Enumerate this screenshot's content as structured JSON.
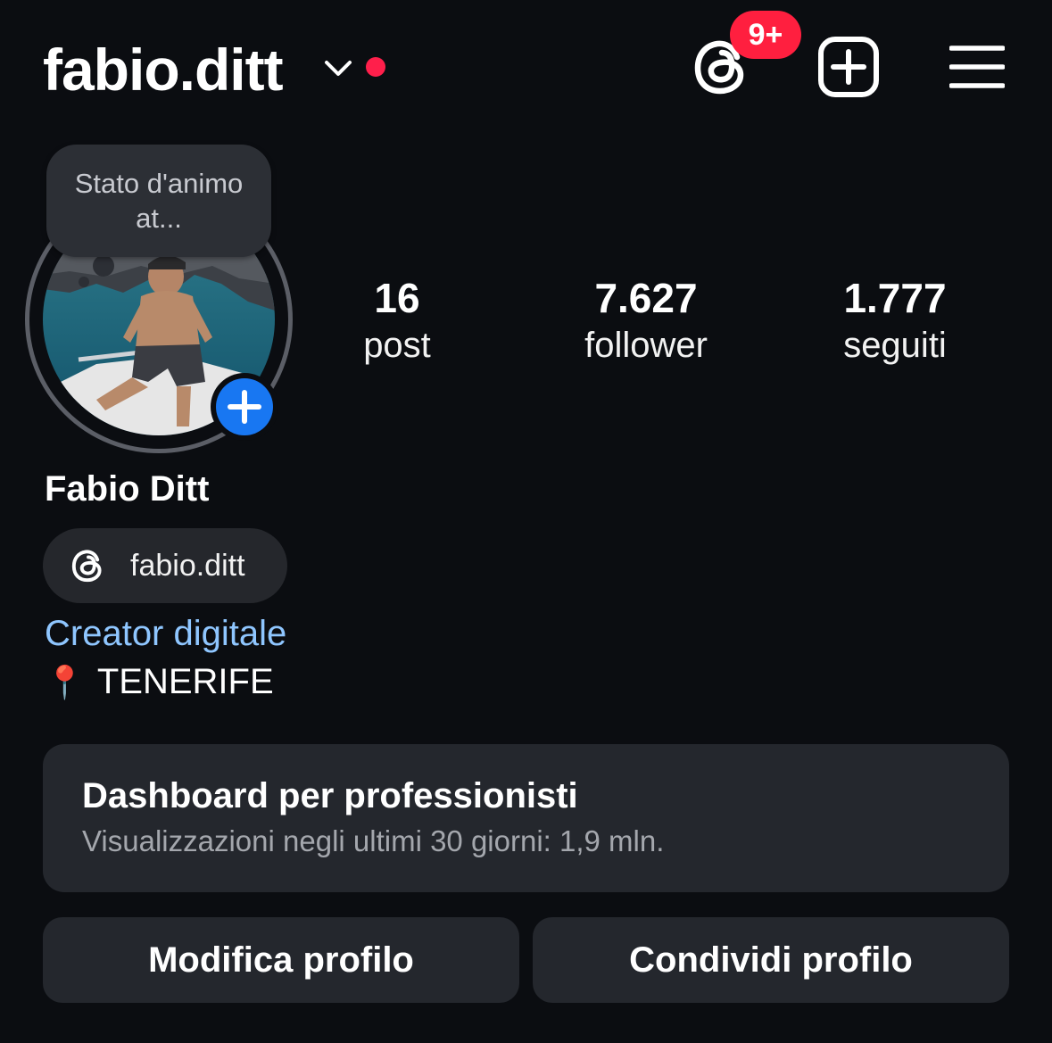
{
  "header": {
    "username": "fabio.ditt",
    "notification_badge": "9+",
    "accent_dot_color": "#ff1f4b"
  },
  "avatar": {
    "note_text": "Stato d'animo at...",
    "icon": "add-story-plus-icon"
  },
  "stats": [
    {
      "value": "16",
      "label": "post"
    },
    {
      "value": "7.627",
      "label": "follower"
    },
    {
      "value": "1.777",
      "label": "seguiti"
    }
  ],
  "profile": {
    "full_name": "Fabio Ditt",
    "threads_handle": "fabio.ditt",
    "category": "Creator digitale",
    "location_emoji": "📍",
    "location": "TENERIFE"
  },
  "dashboard": {
    "title": "Dashboard per professionisti",
    "subtitle": "Visualizzazioni negli ultimi 30 giorni: 1,9 mln."
  },
  "buttons": {
    "edit_profile": "Modifica profilo",
    "share_profile": "Condividi profilo"
  }
}
